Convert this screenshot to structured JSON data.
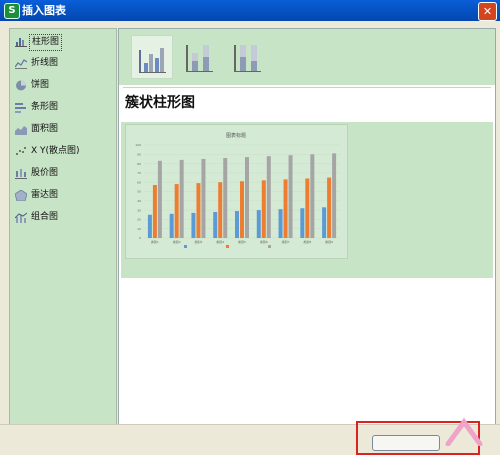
{
  "window": {
    "app_icon_glyph": "S",
    "title": "插入图表",
    "close_glyph": "✕"
  },
  "chart_types": [
    {
      "label": "柱形图",
      "icon": "column-chart-icon"
    },
    {
      "label": "折线图",
      "icon": "line-chart-icon"
    },
    {
      "label": "饼图",
      "icon": "pie-chart-icon"
    },
    {
      "label": "条形图",
      "icon": "bar-chart-icon"
    },
    {
      "label": "面积图",
      "icon": "area-chart-icon"
    },
    {
      "label": "X Y(散点图)",
      "icon": "scatter-chart-icon"
    },
    {
      "label": "股价图",
      "icon": "stock-chart-icon"
    },
    {
      "label": "雷达图",
      "icon": "radar-chart-icon"
    },
    {
      "label": "组合图",
      "icon": "combo-chart-icon"
    }
  ],
  "selected_type": "柱形图",
  "subtypes": [
    "clustered-column-icon",
    "stacked-column-icon",
    "percent-stacked-column-icon"
  ],
  "preview": {
    "title": "簇状柱形图"
  },
  "colors": {
    "series1": "#5b9bd5",
    "series2": "#ed7d31",
    "series3": "#a5a5a5",
    "panel": "#c8e4c7"
  },
  "chart_data": {
    "type": "bar",
    "title": "图表标题",
    "ylim": [
      0,
      100
    ],
    "y_ticks": [
      "0",
      "10",
      "20",
      "30",
      "40",
      "50",
      "60",
      "70",
      "80",
      "90",
      "100"
    ],
    "categories": [
      "类别1",
      "类别2",
      "类别3",
      "类别4",
      "类别5",
      "类别6",
      "类别7",
      "类别8",
      "类别9"
    ],
    "series": [
      {
        "name": "",
        "values": [
          25,
          26,
          27,
          28,
          29,
          30,
          31,
          32,
          33
        ]
      },
      {
        "name": "",
        "values": [
          57,
          58,
          59,
          60,
          61,
          62,
          63,
          64,
          65
        ]
      },
      {
        "name": "",
        "values": [
          83,
          84,
          85,
          86,
          87,
          88,
          89,
          90,
          91
        ]
      }
    ]
  }
}
